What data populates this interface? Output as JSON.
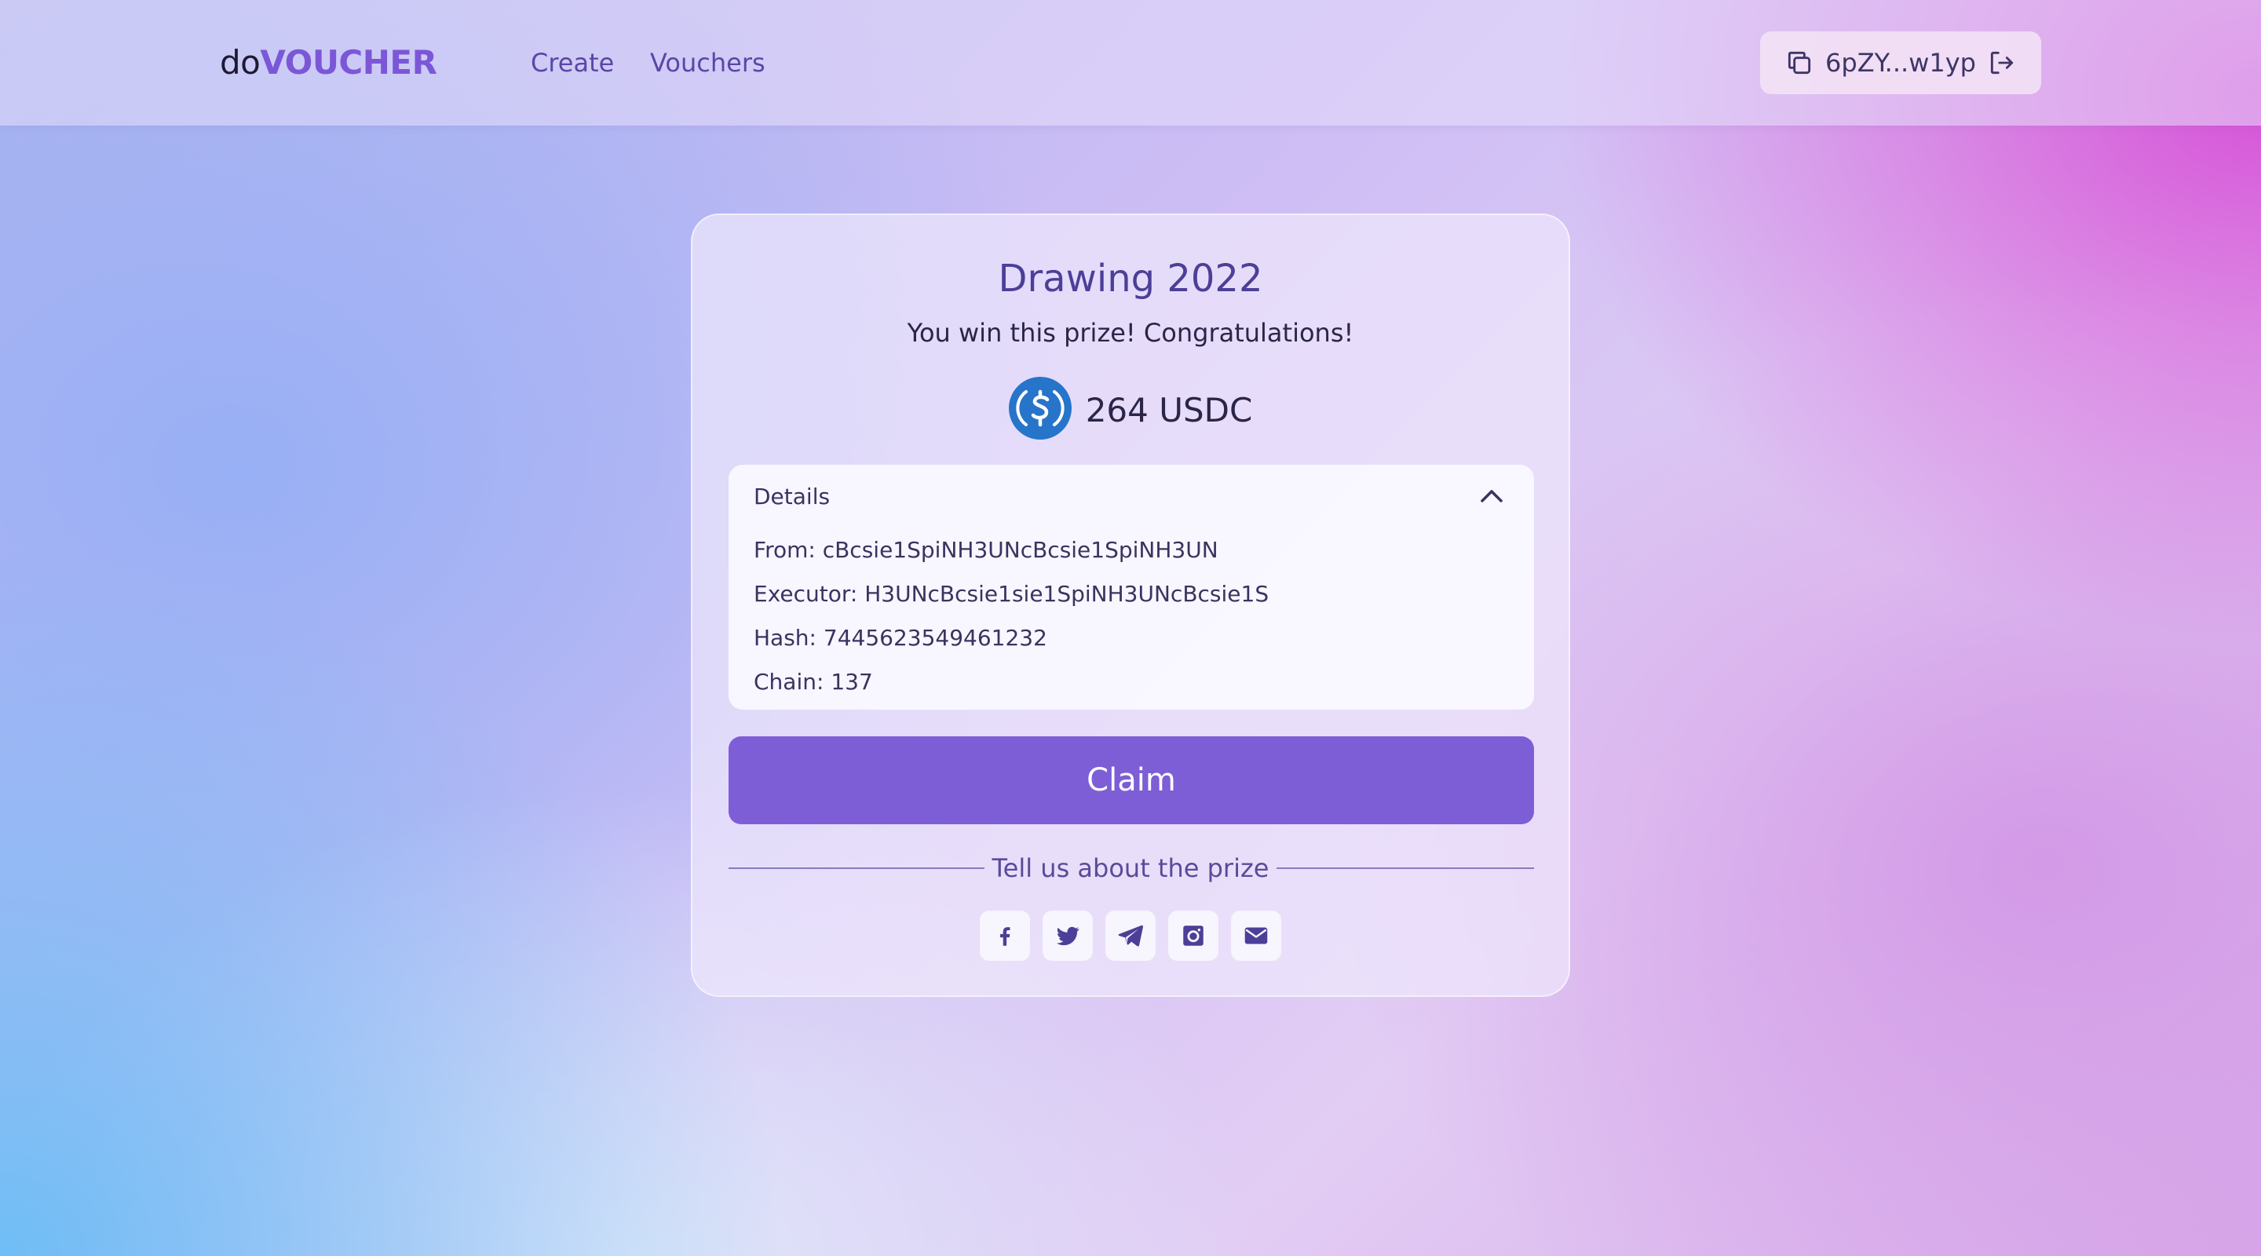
{
  "navbar": {
    "logo_prefix": "do",
    "logo_brand": "VOUCHER",
    "links": [
      "Create",
      "Vouchers"
    ],
    "wallet_address": "6pZY...w1yp"
  },
  "card": {
    "title": "Drawing 2022",
    "subtitle": "You win this prize! Congratulations!",
    "prize_amount": "264 USDC",
    "details": {
      "header": "Details",
      "rows": [
        "From: cBcsie1SpiNH3UNcBcsie1SpiNH3UN",
        "Executor: H3UNcBcsie1sie1SpiNH3UNcBcsie1S",
        "Hash: 7445623549461232",
        "Chain: 137"
      ]
    },
    "claim_label": "Claim",
    "share_label": "Tell us about the prize"
  },
  "icons": {
    "copy": "copy-icon",
    "logout": "logout-icon",
    "coin": "usdc-coin-icon",
    "chevron": "chevron-up-icon",
    "social": [
      "facebook-icon",
      "twitter-icon",
      "telegram-icon",
      "instagram-icon",
      "email-icon"
    ]
  },
  "colors": {
    "accent": "#7d5ed6",
    "brand_text": "#7b57d8",
    "title_text": "#4c3f98",
    "usdc_blue": "#2775ca"
  }
}
